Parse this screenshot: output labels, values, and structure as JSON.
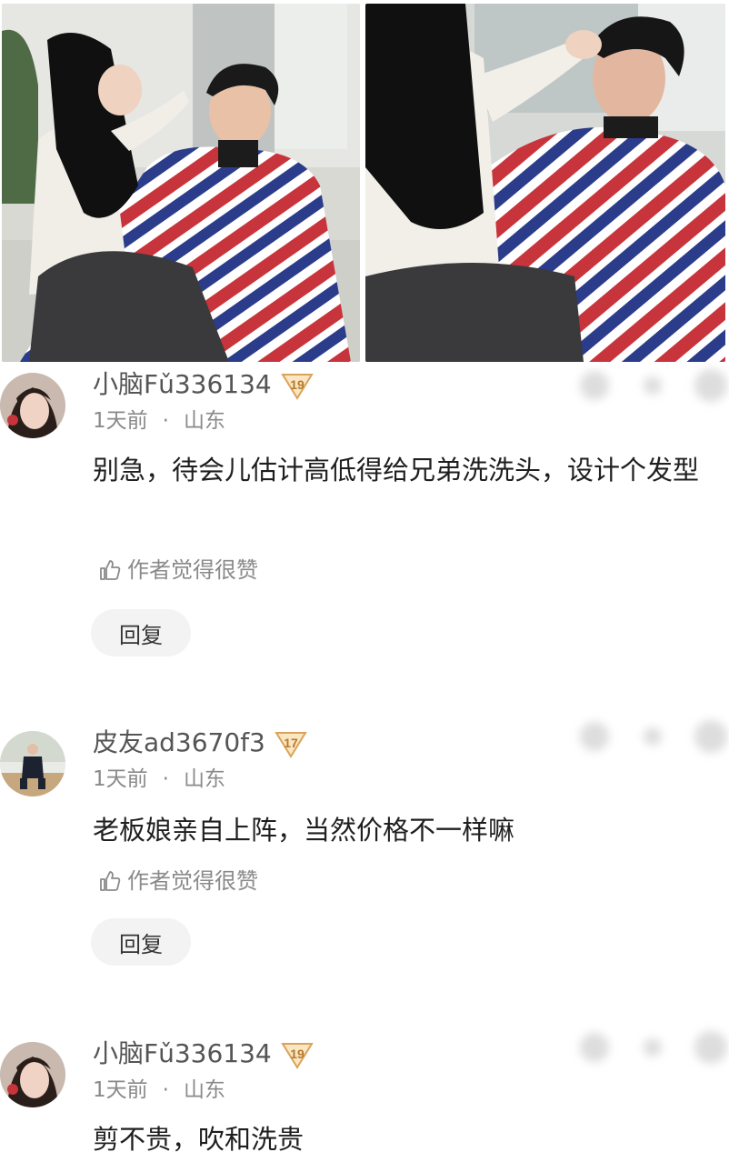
{
  "photos": [
    {
      "icon": "barber-photo-left"
    },
    {
      "icon": "barber-photo-right"
    }
  ],
  "comments": [
    {
      "username": "小脑Fǔ336134",
      "level": "19",
      "level_color": "#d9a35a",
      "time": "1天前",
      "location": "山东",
      "content": "别急，待会儿估计高低得给兄弟洗洗头，设计个发型",
      "like_text": "作者觉得很赞",
      "reply_label": "回复",
      "avatar": "girl-portrait-avatar"
    },
    {
      "username": "皮友ad3670f3",
      "level": "17",
      "level_color": "#d9a35a",
      "time": "1天前",
      "location": "山东",
      "content": "老板娘亲自上阵，当然价格不一样嘛",
      "like_text": "作者觉得很赞",
      "reply_label": "回复",
      "avatar": "man-in-suit-avatar"
    },
    {
      "username": "小脑Fǔ336134",
      "level": "19",
      "level_color": "#d9a35a",
      "time": "1天前",
      "location": "山东",
      "content": "剪不贵，吹和洗贵",
      "avatar": "girl-portrait-avatar"
    }
  ],
  "colors": {
    "stripe_red": "#c8343c",
    "stripe_blue": "#2b3c8a",
    "reply_bg": "#f3f3f3",
    "meta_gray": "#8a8a8a"
  }
}
